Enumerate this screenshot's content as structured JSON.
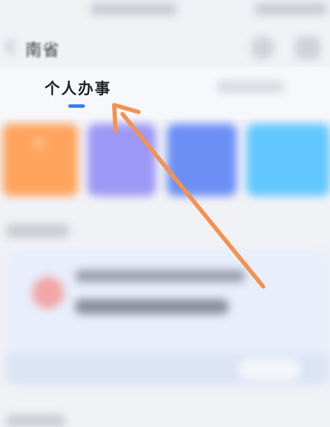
{
  "header": {
    "region_title": "南省"
  },
  "tabs": {
    "active_label": "个人办事"
  },
  "cards": [
    {
      "label": "办"
    }
  ],
  "colors": {
    "accent": "#3d7cf0",
    "arrow": "#f4924f",
    "card_orange": "#ffa45c",
    "card_purple": "#9d98f5",
    "card_blue": "#6c8ff6",
    "card_cyan": "#63c8ff"
  },
  "icons": {
    "back": "chevron-left-icon",
    "search": "search-icon",
    "more": "more-icon"
  }
}
